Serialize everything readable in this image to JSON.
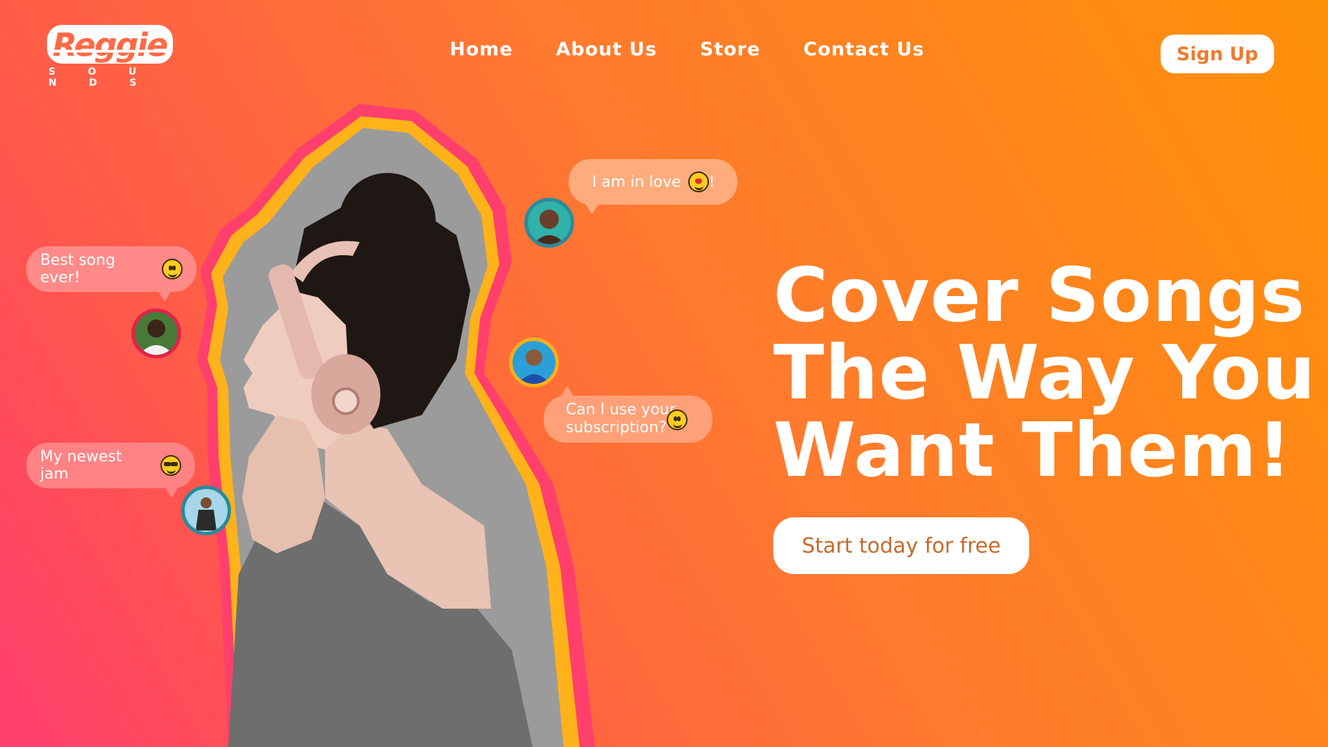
{
  "brand": {
    "name": "Reggie",
    "tagline": "S O U N D S",
    "accent": "#ff6a45"
  },
  "nav": {
    "items": [
      "Home",
      "About Us",
      "Store",
      "Contact Us"
    ],
    "signup_label": "Sign Up"
  },
  "comments": [
    {
      "text": "I am in love",
      "suffix": "!",
      "emoji": "heart-eyes-emoji"
    },
    {
      "text": "Best song ever!",
      "suffix": "",
      "emoji": "grinning-emoji"
    },
    {
      "text": "Can I use your",
      "text2": "subscription?",
      "suffix": "",
      "emoji": "smirk-emoji"
    },
    {
      "text": "My newest jam",
      "suffix": "",
      "emoji": "sunglasses-emoji"
    }
  ],
  "hero": {
    "headline_line1": "Cover Songs",
    "headline_line2": "The Way You",
    "headline_line3": "Want Them!",
    "cta_label": "Start today for free"
  },
  "colors": {
    "gradient_start": "#ff3d6e",
    "gradient_end": "#ff9108",
    "cta_text": "#c86a2a"
  }
}
